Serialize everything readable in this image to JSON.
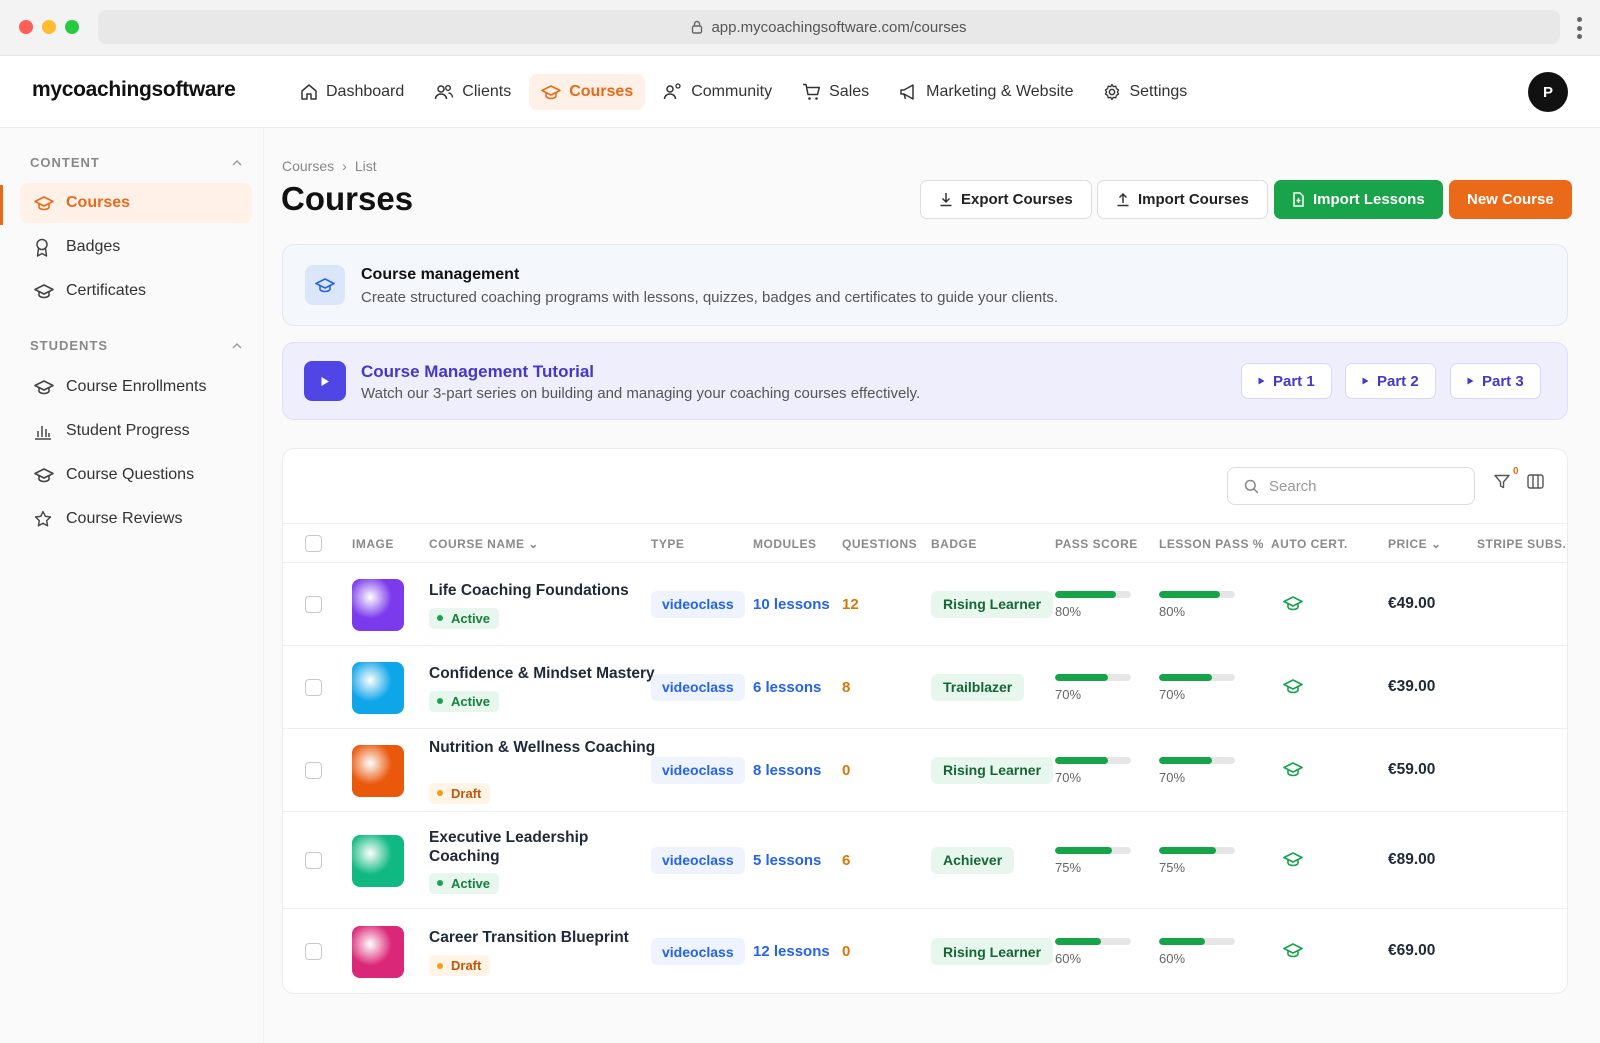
{
  "browser": {
    "url": "app.mycoachingsoftware.com/courses"
  },
  "app": {
    "logo": "mycoachingsoftware",
    "avatar_initial": "P"
  },
  "nav": [
    {
      "label": "Dashboard",
      "icon": "home-icon"
    },
    {
      "label": "Clients",
      "icon": "users-icon"
    },
    {
      "label": "Courses",
      "icon": "graduation-cap-icon",
      "active": true
    },
    {
      "label": "Community",
      "icon": "community-icon"
    },
    {
      "label": "Sales",
      "icon": "cart-icon"
    },
    {
      "label": "Marketing & Website",
      "icon": "megaphone-icon"
    },
    {
      "label": "Settings",
      "icon": "gear-icon"
    }
  ],
  "sidebar": {
    "content_heading": "CONTENT",
    "content_items": [
      {
        "label": "Courses",
        "icon": "graduation-cap-icon",
        "active": true
      },
      {
        "label": "Badges",
        "icon": "award-icon"
      },
      {
        "label": "Certificates",
        "icon": "graduation-cap-icon"
      }
    ],
    "students_heading": "STUDENTS",
    "students_items": [
      {
        "label": "Course Enrollments",
        "icon": "graduation-cap-icon"
      },
      {
        "label": "Student Progress",
        "icon": "bar-chart-icon"
      },
      {
        "label": "Course Questions",
        "icon": "graduation-cap-icon"
      },
      {
        "label": "Course Reviews",
        "icon": "star-icon"
      }
    ]
  },
  "page": {
    "breadcrumb": [
      "Courses",
      "List"
    ],
    "title": "Courses",
    "buttons": {
      "export": "Export Courses",
      "import_courses": "Import Courses",
      "import_lessons": "Import Lessons",
      "new_course": "New Course"
    }
  },
  "info_card": {
    "title": "Course management",
    "text": "Create structured coaching programs with lessons, quizzes, badges and certificates to guide your clients."
  },
  "tutorial": {
    "title": "Course Management Tutorial",
    "text": "Watch our 3-part series on building and managing your coaching courses effectively.",
    "parts": [
      "Part 1",
      "Part 2",
      "Part 3"
    ]
  },
  "table": {
    "search_placeholder": "Search",
    "filter_count": "0",
    "columns": {
      "image": "IMAGE",
      "course_name": "COURSE NAME",
      "type": "TYPE",
      "modules": "MODULES",
      "questions": "QUESTIONS",
      "badge": "BADGE",
      "pass_score": "PASS SCORE",
      "lesson_pass": "LESSON PASS %",
      "auto_cert": "AUTO CERT.",
      "price": "PRICE",
      "stripe": "STRIPE SUBS."
    },
    "rows": [
      {
        "name": "Life Coaching Foundations",
        "status": "Active",
        "type": "videoclass",
        "modules": "10 lessons",
        "questions": "12",
        "badge": "Rising Learner",
        "pass_score": "80%",
        "pass_score_value": 0.8,
        "lesson_pass": "80%",
        "lesson_pass_value": 0.8,
        "price": "€49.00",
        "thumb_color": "#7c3aed"
      },
      {
        "name": "Confidence & Mindset Mastery",
        "status": "Active",
        "type": "videoclass",
        "modules": "6 lessons",
        "questions": "8",
        "badge": "Trailblazer",
        "pass_score": "70%",
        "pass_score_value": 0.7,
        "lesson_pass": "70%",
        "lesson_pass_value": 0.7,
        "price": "€39.00",
        "thumb_color": "#0ea5e9"
      },
      {
        "name": "Nutrition & Wellness Coaching",
        "status": "Draft",
        "type": "videoclass",
        "modules": "8 lessons",
        "questions": "0",
        "badge": "Rising Learner",
        "pass_score": "70%",
        "pass_score_value": 0.7,
        "lesson_pass": "70%",
        "lesson_pass_value": 0.7,
        "price": "€59.00",
        "thumb_color": "#ea580c"
      },
      {
        "name": "Executive Leadership Coaching",
        "status": "Active",
        "type": "videoclass",
        "modules": "5 lessons",
        "questions": "6",
        "badge": "Achiever",
        "pass_score": "75%",
        "pass_score_value": 0.75,
        "lesson_pass": "75%",
        "lesson_pass_value": 0.75,
        "price": "€89.00",
        "thumb_color": "#10b981"
      },
      {
        "name": "Career Transition Blueprint",
        "status": "Draft",
        "type": "videoclass",
        "modules": "12 lessons",
        "questions": "0",
        "badge": "Rising Learner",
        "pass_score": "60%",
        "pass_score_value": 0.6,
        "lesson_pass": "60%",
        "lesson_pass_value": 0.6,
        "price": "€69.00",
        "thumb_color": "#db2777"
      }
    ]
  },
  "colors": {
    "accent": "#ea6a1a",
    "green": "#19a34a",
    "link": "#2563eb",
    "tutorial": "#4f46e5"
  }
}
